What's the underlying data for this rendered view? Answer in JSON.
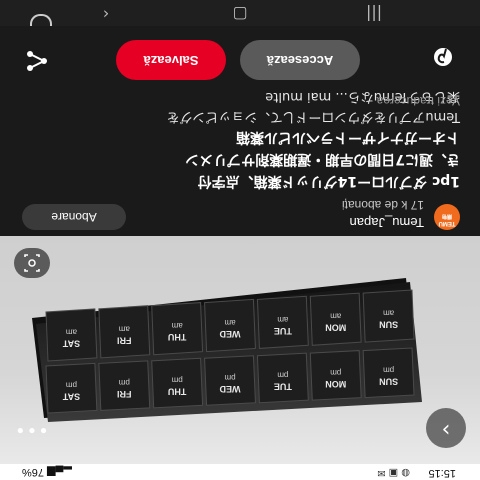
{
  "status_bar": {
    "time": "15:15",
    "battery": "76%",
    "icons": [
      "whatsapp-icon",
      "picture-icon",
      "email-icon",
      "signal-icon"
    ]
  },
  "photo": {
    "compartments_top": [
      {
        "day": "SUN",
        "period": "pm"
      },
      {
        "day": "MON",
        "period": "pm"
      },
      {
        "day": "TUE",
        "period": "pm"
      },
      {
        "day": "WED",
        "period": "pm"
      },
      {
        "day": "THU",
        "period": "pm"
      },
      {
        "day": "FRI",
        "period": "pm"
      },
      {
        "day": "SAT",
        "period": "pm"
      }
    ],
    "compartments_bottom": [
      {
        "day": "SUN",
        "period": "am"
      },
      {
        "day": "MON",
        "period": "am"
      },
      {
        "day": "TUE",
        "period": "am"
      },
      {
        "day": "WED",
        "period": "am"
      },
      {
        "day": "THU",
        "period": "am"
      },
      {
        "day": "FRI",
        "period": "am"
      },
      {
        "day": "SAT",
        "period": "am"
      }
    ]
  },
  "seller": {
    "logo_text": "TEMU",
    "name": "Temu_Japan",
    "followers": "17 k de abonați",
    "subscribe_label": "Abonare"
  },
  "caption": {
    "line1": "1pc ダブルロー14グリッド薬箱、点字付",
    "line2": "き、週に7日間の早期・遅期薬剤サプリメン",
    "line3": "トオーガナイザートラベルピル薬箱",
    "line4": "Temuアプリをダウンロードして、ショッピングを",
    "line5": "楽しもうTemuなら... mai multe",
    "translate": "Vezi traducerea"
  },
  "actions": {
    "access_label": "Accesează",
    "save_label": "Salvează",
    "save_color": "#e60023"
  }
}
